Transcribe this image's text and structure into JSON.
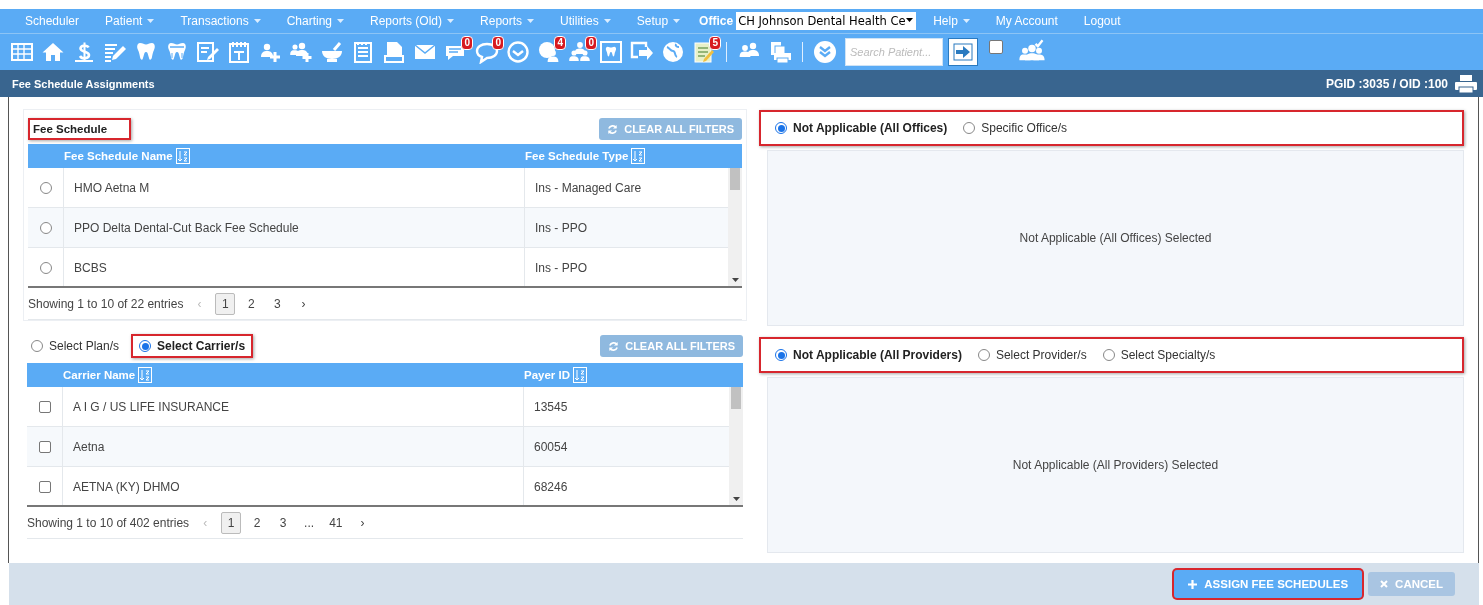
{
  "menu": [
    {
      "label": "Scheduler",
      "dropdown": false
    },
    {
      "label": "Patient",
      "dropdown": true
    },
    {
      "label": "Transactions",
      "dropdown": true
    },
    {
      "label": "Charting",
      "dropdown": true
    },
    {
      "label": "Reports (Old)",
      "dropdown": true
    },
    {
      "label": "Reports",
      "dropdown": true
    },
    {
      "label": "Utilities",
      "dropdown": true
    },
    {
      "label": "Setup",
      "dropdown": true
    }
  ],
  "office": {
    "label": "Office",
    "value": "CH Johnson Dental Health Ce"
  },
  "menu_right": [
    {
      "label": "Help",
      "dropdown": true
    },
    {
      "label": "My Account",
      "dropdown": false
    },
    {
      "label": "Logout",
      "dropdown": false
    }
  ],
  "toolbar": {
    "badges": [
      "0",
      "0",
      "4",
      "0",
      "5"
    ],
    "search": {
      "placeholder": "Search Patient..."
    },
    "checked": false
  },
  "title_bar": {
    "title": "Fee Schedule Assignments",
    "ids": "PGID :3035 / OID :100"
  },
  "fee_schedule": {
    "label": "Fee Schedule",
    "highlighted": true,
    "clear_button": "CLEAR ALL FILTERS",
    "table": {
      "columns": [
        "Fee Schedule Name",
        "Fee Schedule Type"
      ],
      "rows": [
        {
          "cells": [
            "HMO Aetna M",
            "Ins - Managed Care"
          ],
          "selected": false
        },
        {
          "cells": [
            "PPO Delta Dental-Cut Back Fee Schedule",
            "Ins - PPO"
          ],
          "selected": false
        },
        {
          "cells": [
            "BCBS",
            "Ins - PPO"
          ],
          "selected": false
        }
      ]
    },
    "pagination": {
      "summary": "Showing 1 to 10 of 22 entries",
      "prev": {
        "label": "‹",
        "disabled": true
      },
      "next": {
        "label": "›",
        "disabled": false
      },
      "pages": [
        {
          "label": "1",
          "selected": true
        },
        {
          "label": "2",
          "selected": false
        },
        {
          "label": "3",
          "selected": false
        }
      ]
    }
  },
  "carrier_section": {
    "options": [
      {
        "label": "Select Plan/s",
        "selected": false,
        "highlighted": false
      },
      {
        "label": "Select Carrier/s",
        "selected": true,
        "highlighted": true
      }
    ],
    "clear_button": "CLEAR ALL FILTERS",
    "table": {
      "columns": [
        "Carrier Name",
        "Payer ID"
      ],
      "rows": [
        {
          "cells": [
            "A I G / US LIFE INSURANCE",
            "13545"
          ],
          "checked": false
        },
        {
          "cells": [
            "Aetna",
            "60054"
          ],
          "checked": false
        },
        {
          "cells": [
            "AETNA (KY) DHMO",
            "68246"
          ],
          "checked": false
        }
      ]
    },
    "pagination": {
      "summary": "Showing 1 to 10 of 402 entries",
      "prev": {
        "label": "‹",
        "disabled": true
      },
      "next": {
        "label": "›",
        "disabled": false
      },
      "pages": [
        {
          "label": "1",
          "selected": true
        },
        {
          "label": "2",
          "selected": false
        },
        {
          "label": "3",
          "selected": false
        },
        {
          "label": "...",
          "selected": false
        },
        {
          "label": "41",
          "selected": false
        }
      ]
    }
  },
  "office_scope": {
    "highlighted": true,
    "options": [
      {
        "label": "Not Applicable (All Offices)",
        "selected": true
      },
      {
        "label": "Specific Office/s",
        "selected": false
      }
    ],
    "message": "Not Applicable (All Offices) Selected"
  },
  "provider_scope": {
    "highlighted": true,
    "options": [
      {
        "label": "Not Applicable (All Providers)",
        "selected": true
      },
      {
        "label": "Select Provider/s",
        "selected": false
      },
      {
        "label": "Select Specialty/s",
        "selected": false
      }
    ],
    "message": "Not Applicable (All Providers) Selected"
  },
  "footer": {
    "buttons": [
      {
        "label": "ASSIGN FEE SCHEDULES",
        "kind": "assign",
        "highlighted": true
      },
      {
        "label": "CANCEL",
        "kind": "cancel",
        "highlighted": false
      }
    ]
  }
}
